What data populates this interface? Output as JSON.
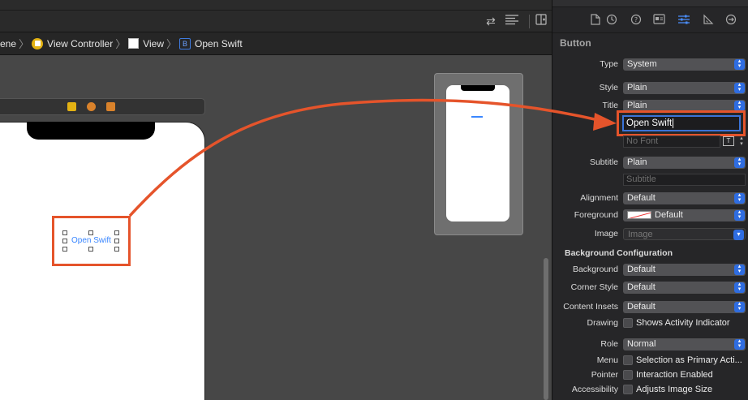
{
  "breadcrumb": {
    "scene": "ene",
    "view_controller": "View Controller",
    "view": "View",
    "button_icon_letter": "B",
    "button": "Open Swift"
  },
  "canvas": {
    "button_label": "Open Swift"
  },
  "inspector": {
    "section_title": "Button",
    "rows": {
      "type": {
        "label": "Type",
        "value": "System"
      },
      "style": {
        "label": "Style",
        "value": "Plain"
      },
      "title": {
        "label": "Title",
        "value": "Plain",
        "text": "Open Swift"
      },
      "font": {
        "placeholder": "No Font",
        "button": "T"
      },
      "subtitle": {
        "label": "Subtitle",
        "value": "Plain",
        "placeholder": "Subtitle"
      },
      "alignment": {
        "label": "Alignment",
        "value": "Default"
      },
      "foreground": {
        "label": "Foreground",
        "value": "Default"
      },
      "image": {
        "label": "Image",
        "placeholder": "Image"
      }
    },
    "background_config": {
      "title": "Background Configuration",
      "background": {
        "label": "Background",
        "value": "Default"
      },
      "corner_style": {
        "label": "Corner Style",
        "value": "Default"
      },
      "content_insets": {
        "label": "Content Insets",
        "value": "Default"
      },
      "drawing": {
        "label": "Drawing",
        "checkbox": "Shows Activity Indicator"
      },
      "role": {
        "label": "Role",
        "value": "Normal"
      },
      "menu": {
        "label": "Menu",
        "checkbox": "Selection as Primary Acti..."
      },
      "pointer": {
        "label": "Pointer",
        "checkbox": "Interaction Enabled"
      },
      "accessibility": {
        "label": "Accessibility",
        "checkbox": "Adjusts Image Size"
      }
    }
  },
  "colors": {
    "accent": "#2f6de1",
    "annotation": "#e5542b",
    "button_tint": "#3b87ff"
  },
  "icons": {
    "toolbar": [
      "refresh-arrows-icon",
      "lines-icon",
      "add-editor-icon"
    ],
    "inspector_tabs": [
      "file-icon",
      "history-icon",
      "help-icon",
      "identity-icon",
      "attributes-icon",
      "size-icon",
      "connections-icon"
    ]
  }
}
